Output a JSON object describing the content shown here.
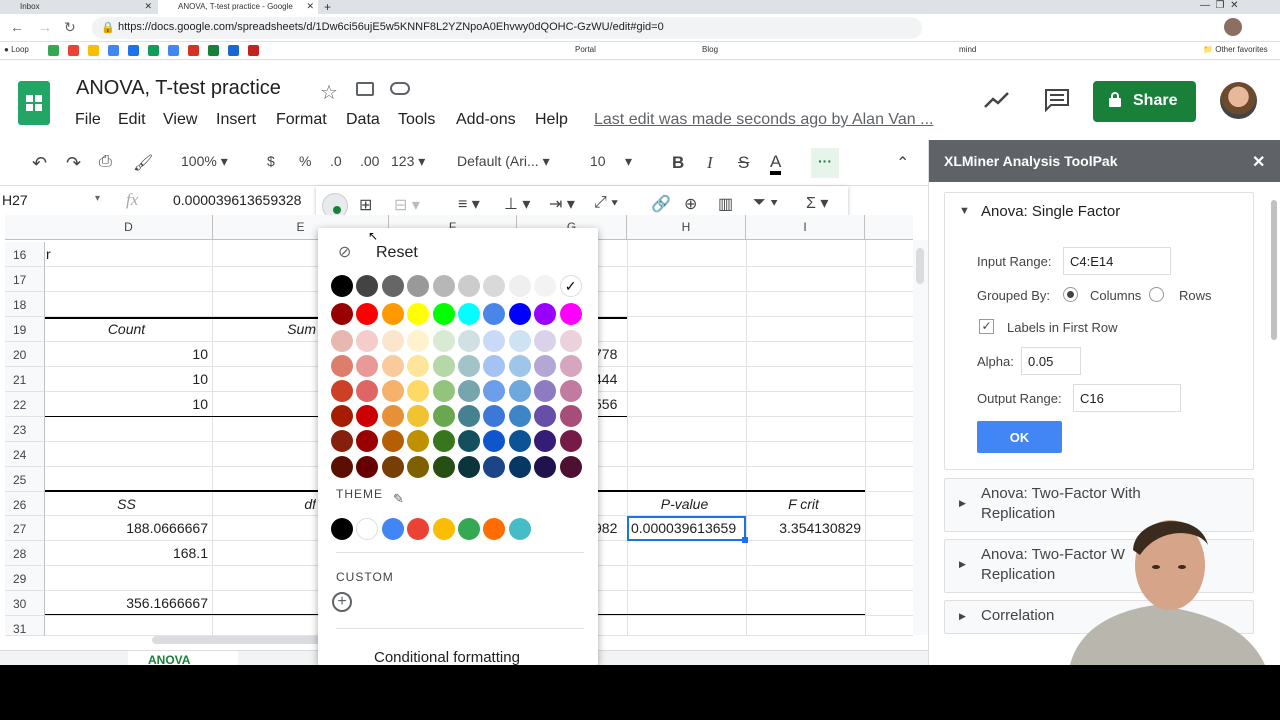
{
  "browser": {
    "tabs": [
      {
        "title": "Inbox"
      },
      {
        "title": "ANOVA, T-test practice - Google"
      }
    ],
    "url": "https://docs.google.com/spreadsheets/d/1Dw6ci56ujE5w5KNNF8L2YZNpoA0Ehvwy0dQOHC-GzWU/edit#gid=0",
    "bookmarks": [
      "Loop",
      "Portal",
      "Blog",
      "mind",
      "Other favorites"
    ]
  },
  "doc": {
    "title": "ANOVA, T-test practice",
    "menus": [
      "File",
      "Edit",
      "View",
      "Insert",
      "Format",
      "Data",
      "Tools",
      "Add-ons",
      "Help"
    ],
    "last_edit": "Last edit was made seconds ago by Alan Van ...",
    "share_label": "Share"
  },
  "toolbar": {
    "zoom": "100%",
    "currency": "$",
    "percent": "%",
    "dec_dec": ".0",
    "dec_inc": ".00",
    "more_formats": "123",
    "font": "Default (Ari...",
    "font_size": "10",
    "bold": "B",
    "italic": "I",
    "strike": "S",
    "text_color": "A",
    "more": "···"
  },
  "formula_bar": {
    "cell_ref": "H27",
    "fx": "fx",
    "value": "0.000039613659328"
  },
  "grid": {
    "columns": [
      "D",
      "E",
      "F",
      "G",
      "H",
      "I"
    ],
    "rows": [
      {
        "num": "16",
        "cells": [
          {
            "col": "D",
            "text": "r"
          }
        ]
      },
      {
        "num": "17",
        "cells": []
      },
      {
        "num": "18",
        "cells": []
      },
      {
        "num": "19",
        "cells": [
          {
            "col": "D",
            "text": "Count",
            "italic": true
          },
          {
            "col": "E",
            "text": "Sum",
            "italic": true
          }
        ]
      },
      {
        "num": "20",
        "cells": [
          {
            "col": "D",
            "text": "10"
          },
          {
            "col": "G",
            "text": "778"
          }
        ]
      },
      {
        "num": "21",
        "cells": [
          {
            "col": "D",
            "text": "10"
          },
          {
            "col": "G",
            "text": "444"
          }
        ]
      },
      {
        "num": "22",
        "cells": [
          {
            "col": "D",
            "text": "10"
          },
          {
            "col": "G",
            "text": "556"
          }
        ]
      },
      {
        "num": "23",
        "cells": []
      },
      {
        "num": "24",
        "cells": []
      },
      {
        "num": "25",
        "cells": []
      },
      {
        "num": "26",
        "cells": [
          {
            "col": "D",
            "text": "SS",
            "italic": true
          },
          {
            "col": "E",
            "text": "df",
            "italic": true
          },
          {
            "col": "H",
            "text": "P-value",
            "italic": true
          },
          {
            "col": "I",
            "text": "F crit",
            "italic": true
          }
        ]
      },
      {
        "num": "27",
        "cells": [
          {
            "col": "D",
            "text": "188.0666667"
          },
          {
            "col": "G",
            "text": "982"
          },
          {
            "col": "H",
            "text": "0.000039613659"
          },
          {
            "col": "I",
            "text": "3.354130829"
          }
        ]
      },
      {
        "num": "28",
        "cells": [
          {
            "col": "D",
            "text": "168.1"
          }
        ]
      },
      {
        "num": "29",
        "cells": []
      },
      {
        "num": "30",
        "cells": [
          {
            "col": "D",
            "text": "356.1666667"
          }
        ]
      },
      {
        "num": "31",
        "cells": []
      }
    ]
  },
  "palette": {
    "reset_label": "Reset",
    "theme_label": "THEME",
    "custom_label": "CUSTOM",
    "conditional_label": "Conditional formatting",
    "grid_colors": [
      [
        "#000000",
        "#434343",
        "#666666",
        "#999999",
        "#b7b7b7",
        "#cccccc",
        "#d9d9d9",
        "#efefef",
        "#f3f3f3",
        "#ffffff"
      ],
      [
        "#980000",
        "#ff0000",
        "#ff9900",
        "#ffff00",
        "#00ff00",
        "#00ffff",
        "#4a86e8",
        "#0000ff",
        "#9900ff",
        "#ff00ff"
      ],
      [
        "#e6b8af",
        "#f4cccc",
        "#fce5cd",
        "#fff2cc",
        "#d9ead3",
        "#d0e0e3",
        "#c9daf8",
        "#cfe2f3",
        "#d9d2e9",
        "#ead1dc"
      ],
      [
        "#dd7e6b",
        "#ea9999",
        "#f9cb9c",
        "#ffe599",
        "#b6d7a8",
        "#a2c4c9",
        "#a4c2f4",
        "#9fc5e8",
        "#b4a7d6",
        "#d5a6bd"
      ],
      [
        "#cc4125",
        "#e06666",
        "#f6b26b",
        "#ffd966",
        "#93c47d",
        "#76a5af",
        "#6d9eeb",
        "#6fa8dc",
        "#8e7cc3",
        "#c27ba0"
      ],
      [
        "#a61c00",
        "#cc0000",
        "#e69138",
        "#f1c232",
        "#6aa84f",
        "#45818e",
        "#3c78d8",
        "#3d85c6",
        "#674ea7",
        "#a64d79"
      ],
      [
        "#85200c",
        "#990000",
        "#b45f06",
        "#bf9000",
        "#38761d",
        "#134f5c",
        "#1155cc",
        "#0b5394",
        "#351c75",
        "#741b47"
      ],
      [
        "#5b0f00",
        "#660000",
        "#783f04",
        "#7f6000",
        "#274e13",
        "#0c343d",
        "#1c4587",
        "#073763",
        "#20124d",
        "#4c1130"
      ]
    ],
    "theme_colors": [
      "#000000",
      "#ffffff",
      "#4285f4",
      "#ea4335",
      "#fbbc04",
      "#34a853",
      "#ff6d01",
      "#46bdc6"
    ]
  },
  "panel": {
    "title": "XLMiner Analysis ToolPak",
    "active_section": "Anova: Single Factor",
    "input_range_label": "Input Range:",
    "input_range": "C4:E14",
    "grouped_by_label": "Grouped By:",
    "columns_label": "Columns",
    "rows_label": "Rows",
    "labels_first_row": "Labels in First Row",
    "alpha_label": "Alpha:",
    "alpha": "0.05",
    "output_range_label": "Output Range:",
    "output_range": "C16",
    "ok_label": "OK",
    "sections": [
      "Anova: Two-Factor With Replication",
      "Anova: Two-Factor W Replication",
      "Correlation"
    ]
  },
  "sheet_tabs": [
    "ANOVA"
  ]
}
